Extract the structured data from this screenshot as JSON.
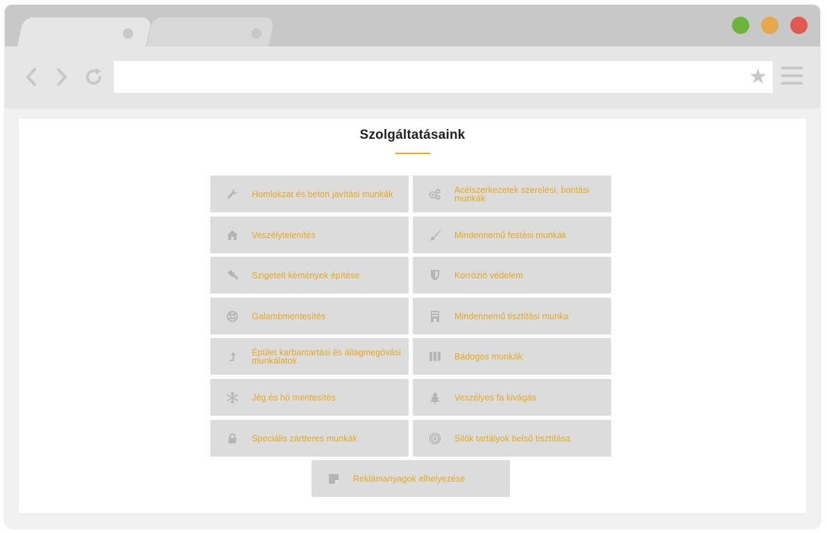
{
  "colors": {
    "accent": "#e6a81c",
    "icon_gray": "#b5b5b5",
    "card_bg": "#dcdcdc",
    "window_green": "#6cb53c",
    "window_yellow": "#e6a84a",
    "window_red": "#df5b52"
  },
  "browser": {
    "window_buttons": [
      "maximize",
      "minimize",
      "close"
    ],
    "nav_icons": [
      "back-icon",
      "forward-icon",
      "reload-icon"
    ],
    "address_value": "",
    "bookmark_icon": "star-icon",
    "menu_icon": "hamburger-menu-icon"
  },
  "page": {
    "title": "Szolgáltatásaink",
    "services": [
      {
        "label": "Homlokzat és beton javítási munkák",
        "icon": "wrench-icon"
      },
      {
        "label": "Acélszerkezetek szerelési, bontási munkák",
        "icon": "gears-icon"
      },
      {
        "label": "Veszélytelenítés",
        "icon": "home-icon"
      },
      {
        "label": "Mindennemű festési munkák",
        "icon": "paintbrush-icon"
      },
      {
        "label": "Szigetelt kémények építése",
        "icon": "gavel-icon"
      },
      {
        "label": "Korrózió védelem",
        "icon": "shield-icon"
      },
      {
        "label": "Galambmentesítés",
        "icon": "lifebuoy-icon"
      },
      {
        "label": "Mindennemű tisztítási munka",
        "icon": "building-icon"
      },
      {
        "label": "Épület karbantartási és állagmegóvási munkálatok",
        "icon": "level-up-arrow-icon"
      },
      {
        "label": "Bádogos munkák",
        "icon": "map-icon"
      },
      {
        "label": "Jég és hó mentesítés",
        "icon": "snowflake-icon"
      },
      {
        "label": "Veszélyes fa kivágás",
        "icon": "tree-icon"
      },
      {
        "label": "Speciális zártteres munkák",
        "icon": "lock-icon"
      },
      {
        "label": "Silók tartályok belső tisztítása",
        "icon": "target-icon"
      },
      {
        "label": "Reklámanyagok elhelyezése",
        "icon": "sticky-note-icon"
      }
    ]
  }
}
